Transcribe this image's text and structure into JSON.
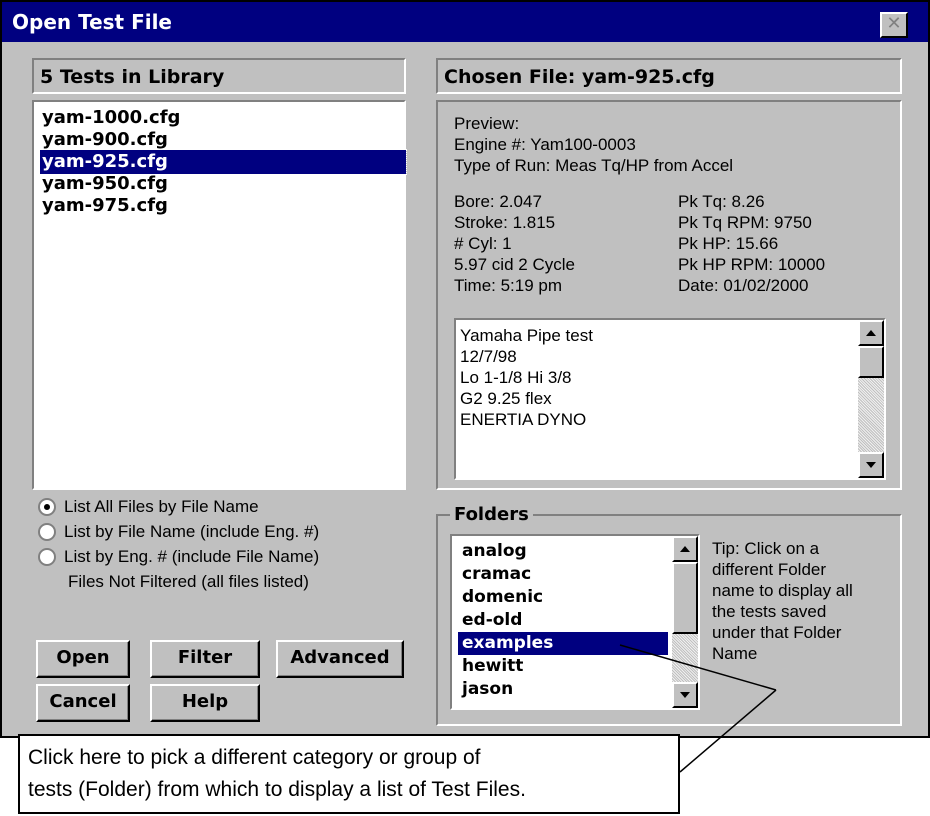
{
  "window": {
    "title": "Open Test File",
    "close_glyph": "✕"
  },
  "library": {
    "header": "5 Tests in Library",
    "files": [
      "yam-1000.cfg",
      "yam-900.cfg",
      "yam-925.cfg",
      "yam-950.cfg",
      "yam-975.cfg"
    ],
    "selected_index": 2
  },
  "chosen": {
    "header": "Chosen File: yam-925.cfg",
    "preview_label": "Preview:",
    "engine": "Engine #: Yam100-0003",
    "run_type": "Type of Run: Meas Tq/HP from Accel",
    "left_stats": [
      "Bore: 2.047",
      "Stroke: 1.815",
      "# Cyl: 1",
      "5.97 cid  2 Cycle",
      "Time: 5:19 pm"
    ],
    "right_stats": [
      "Pk Tq: 8.26",
      "Pk Tq RPM:  9750",
      "Pk HP: 15.66",
      "Pk HP RPM:  10000",
      "Date: 01/02/2000"
    ],
    "notes": [
      "Yamaha Pipe test",
      "12/7/98",
      "Lo 1-1/8 Hi 3/8",
      "G2 9.25 flex",
      "ENERTIA DYNO"
    ]
  },
  "list_options": {
    "items": [
      {
        "label": "List All Files by File Name",
        "checked": true
      },
      {
        "label": "List by File Name (include Eng. #)",
        "checked": false
      },
      {
        "label": "List by Eng. # (include File Name)",
        "checked": false
      }
    ],
    "filter_status": "Files Not Filtered (all files listed)"
  },
  "buttons": {
    "open": "Open",
    "filter": "Filter",
    "advanced": "Advanced",
    "cancel": "Cancel",
    "help": "Help"
  },
  "folders": {
    "label": "Folders",
    "items": [
      "analog",
      "cramac",
      "domenic",
      "ed-old",
      "examples",
      "hewitt",
      "jason"
    ],
    "selected_index": 4,
    "tip": [
      "Tip:  Click on a",
      "different Folder",
      "name to display all",
      "the tests saved",
      "under that Folder",
      "Name"
    ]
  },
  "callout": {
    "lines": [
      "Click here to pick a different  category  or group of",
      "tests (Folder) from which to display a list of Test Files."
    ]
  }
}
